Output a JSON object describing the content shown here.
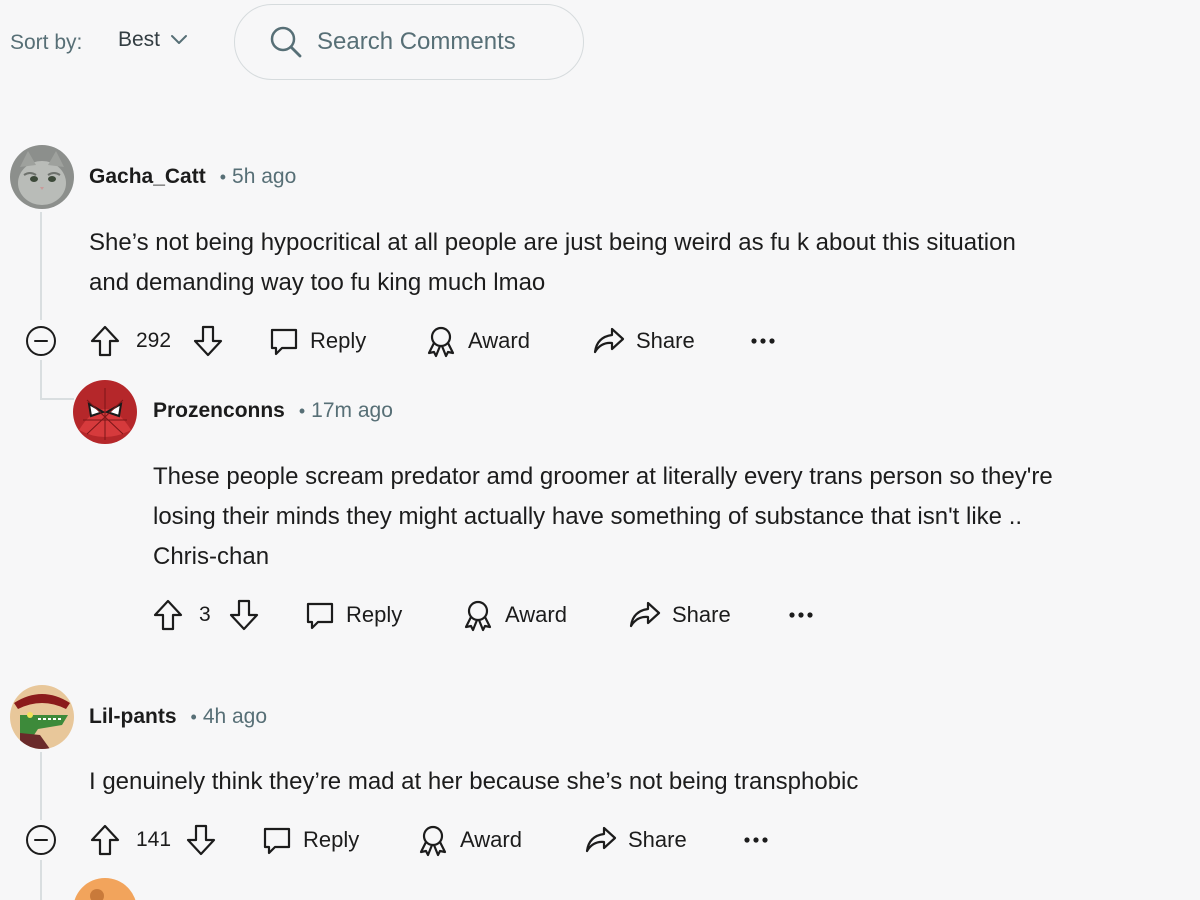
{
  "toolbar": {
    "sort_label": "Sort by:",
    "sort_value": "Best",
    "search_placeholder": "Search Comments"
  },
  "comments": [
    {
      "author": "Gacha_Catt",
      "time": "5h ago",
      "lines": [
        "She’s not being hypocritical at all people are just being weird as fu  k about this situation",
        "and demanding way too fu  king much lmao"
      ],
      "votes": "292",
      "reply_label": "Reply",
      "award_label": "Award",
      "share_label": "Share"
    },
    {
      "author": "Prozenconns",
      "time": "17m ago",
      "lines": [
        "These people scream predator amd groomer at literally every trans person so they're",
        "losing their minds they might actually have something of substance that isn't like ..",
        "Chris-chan"
      ],
      "votes": "3",
      "reply_label": "Reply",
      "award_label": "Award",
      "share_label": "Share"
    },
    {
      "author": "Lil-pants",
      "time": "4h ago",
      "lines": [
        "I genuinely think they’re mad at her because she’s not being transphobic"
      ],
      "votes": "141",
      "reply_label": "Reply",
      "award_label": "Award",
      "share_label": "Share"
    }
  ],
  "icons": {
    "search": "search-icon",
    "chevron": "chevron-down-icon",
    "collapse": "collapse-icon",
    "upvote": "upvote-icon",
    "downvote": "downvote-icon",
    "reply": "comment-bubble-icon",
    "award": "award-icon",
    "share": "share-arrow-icon",
    "more": "more-options-icon"
  },
  "colors": {
    "background": "#f7f7f8",
    "meta_text": "#576f76",
    "text": "#1c1c1c",
    "thread_line": "#d9dee0"
  }
}
